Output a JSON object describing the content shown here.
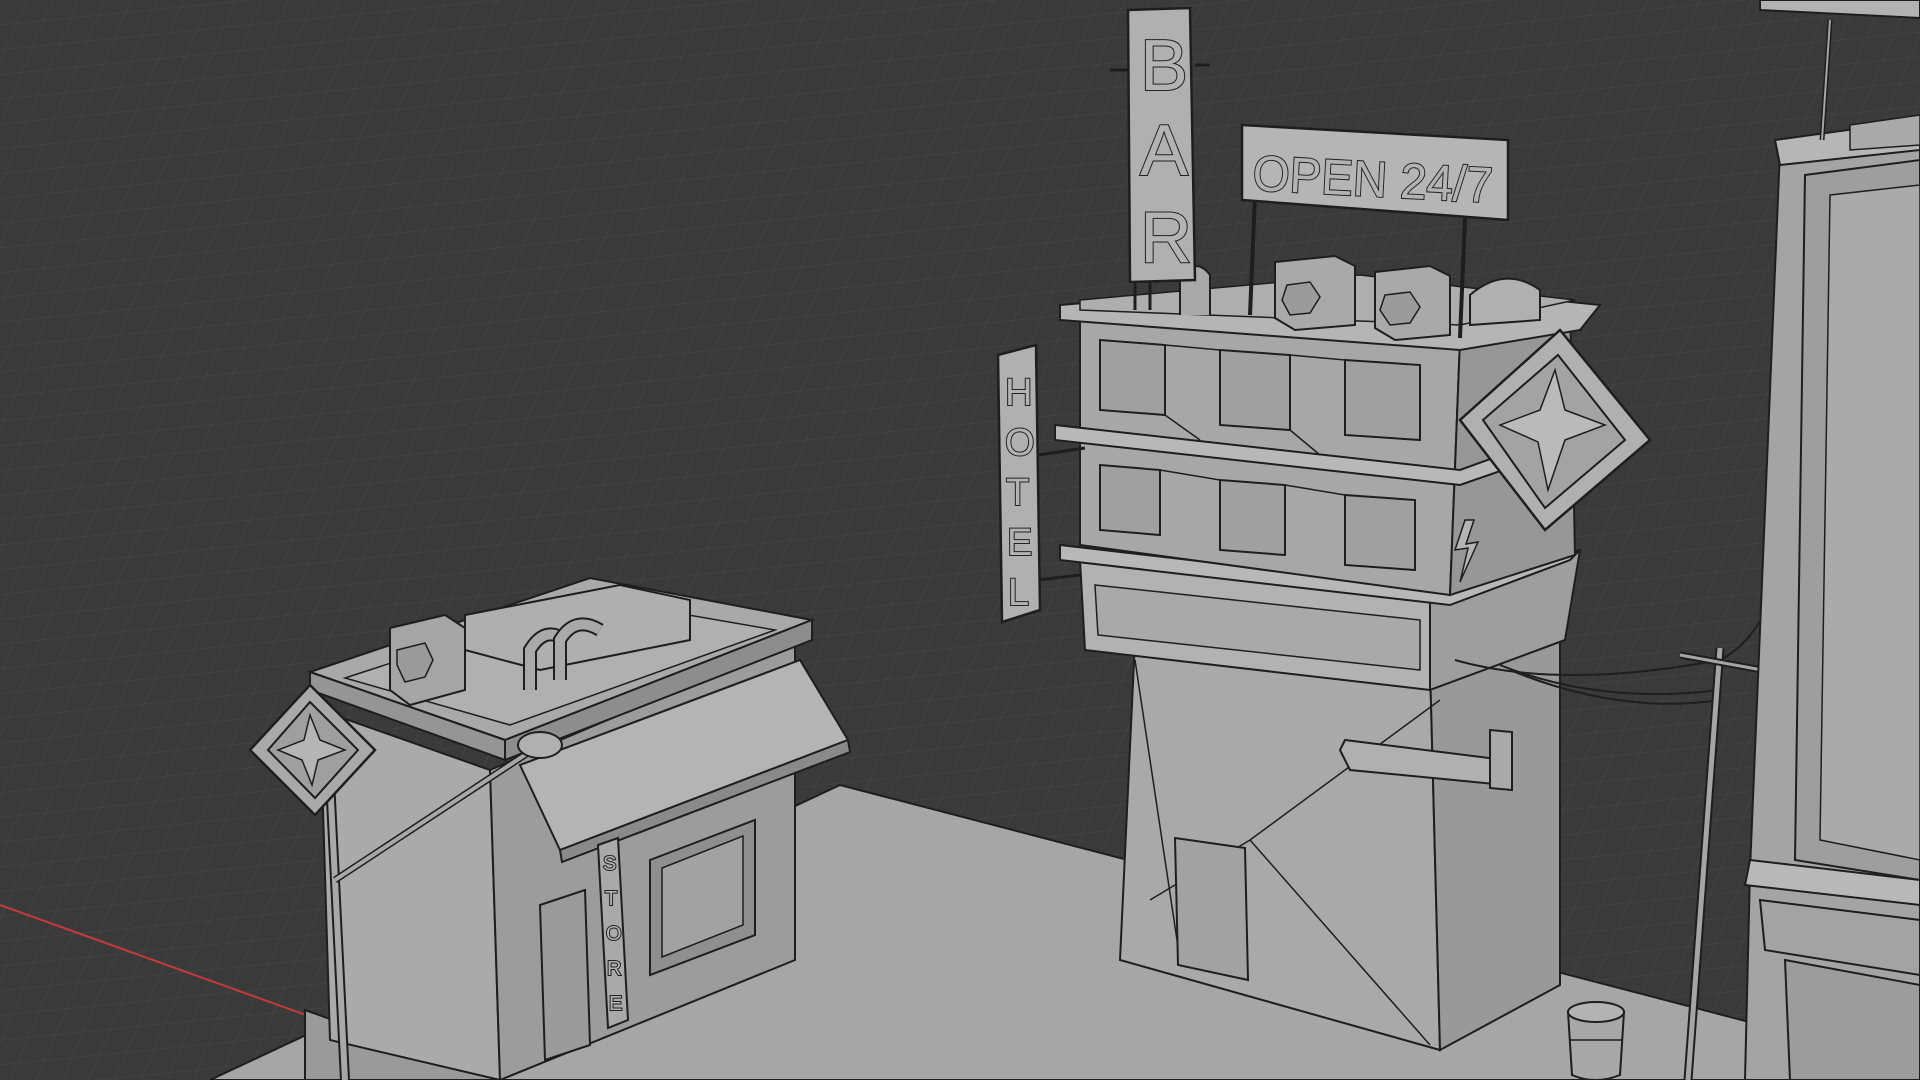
{
  "viewport": {
    "mode": "3D wireframe-shaded viewport",
    "colors": {
      "background": "#3a3a3a",
      "grid_line": "#464646",
      "x_axis": "#c23a3a",
      "ground": "#a8a8a8",
      "building": "#ababab",
      "building_dark": "#8f8f8f",
      "edge": "#1e1e1e"
    }
  },
  "signs": {
    "bar": [
      "B",
      "A",
      "R"
    ],
    "open": "OPEN 24/7",
    "hotel": [
      "H",
      "O",
      "T",
      "E",
      "L"
    ],
    "store": [
      "S",
      "T",
      "O",
      "R",
      "E"
    ]
  }
}
